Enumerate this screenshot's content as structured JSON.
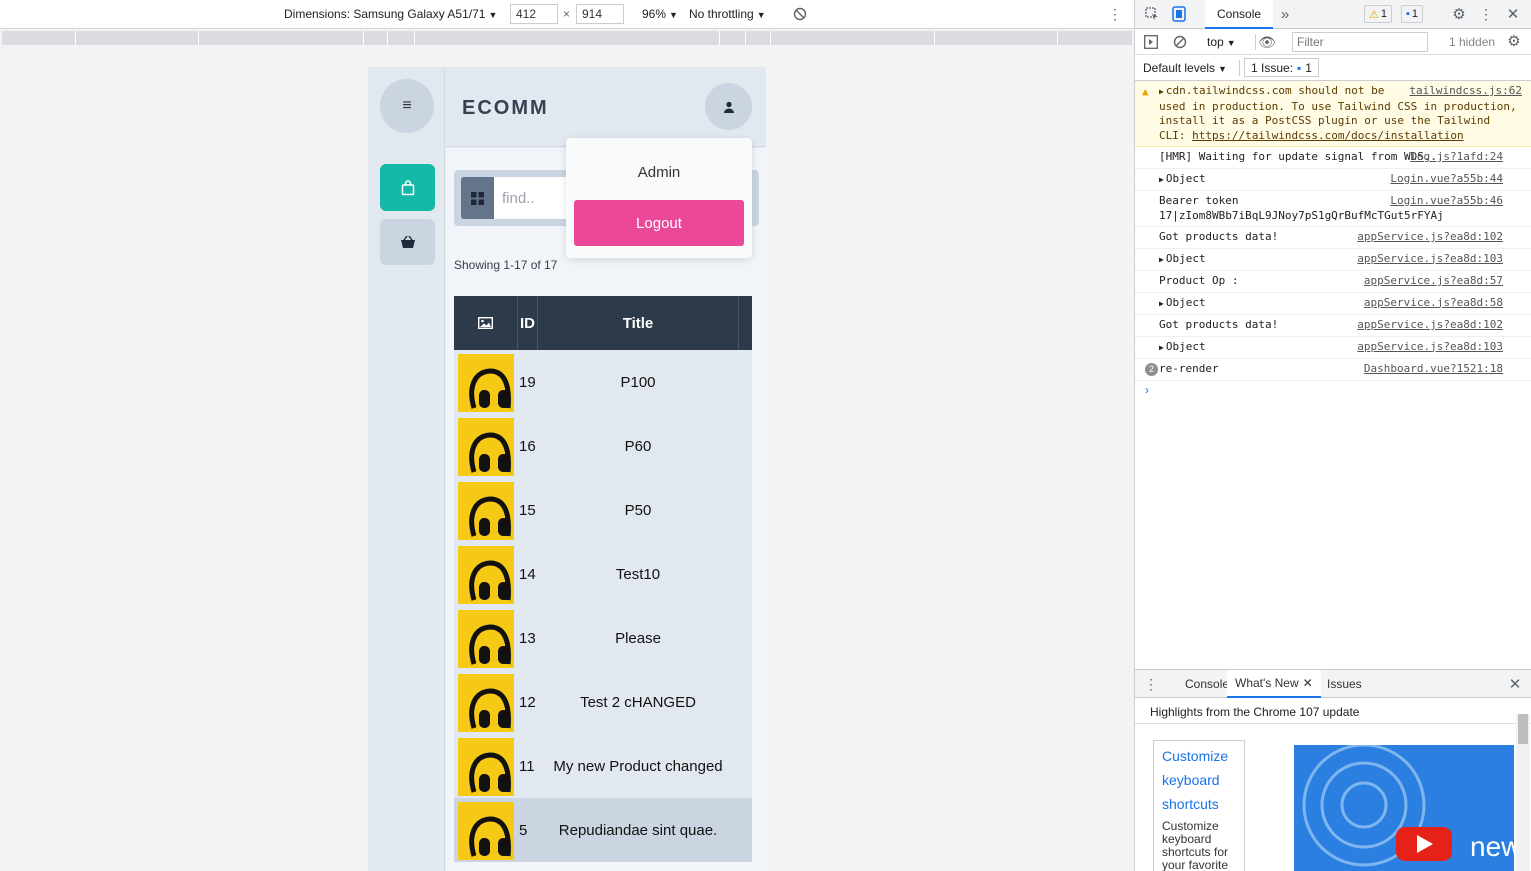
{
  "device_toolbar": {
    "dimensions_label": "Dimensions: Samsung Galaxy A51/71",
    "width": "412",
    "times": "×",
    "height": "914",
    "zoom": "96%",
    "throttling": "No throttling"
  },
  "app": {
    "brand": "ECOMM",
    "search_placeholder": "find..",
    "showing": "Showing 1-17 of 17",
    "table": {
      "headers": {
        "id": "ID",
        "title": "Title"
      },
      "rows": [
        {
          "id": "19",
          "title": "P100"
        },
        {
          "id": "16",
          "title": "P60"
        },
        {
          "id": "15",
          "title": "P50"
        },
        {
          "id": "14",
          "title": "Test10"
        },
        {
          "id": "13",
          "title": "Please"
        },
        {
          "id": "12",
          "title": "Test 2 cHANGED"
        },
        {
          "id": "11",
          "title": "My new Product changed"
        },
        {
          "id": "5",
          "title": "Repudiandae sint quae."
        }
      ]
    },
    "user_menu": {
      "name": "Admin",
      "logout": "Logout"
    },
    "colors": {
      "accent": "#14b8a6",
      "logout": "#ec4899",
      "table_header": "#2d3a4a"
    }
  },
  "devtools": {
    "tabs": {
      "console": "Console",
      "more": "»"
    },
    "warnings_count": "1",
    "messages_count": "1",
    "context": "top",
    "filter_placeholder": "Filter",
    "hidden": "1 hidden",
    "levels": "Default levels",
    "issues": "1 Issue:",
    "issues_count": "1",
    "logs": [
      {
        "kind": "warn",
        "text": "cdn.tailwindcss.com should not be used in production. To use Tailwind CSS in production, install it as a PostCSS plugin or use the Tailwind CLI: ",
        "link": "https://tailwindcss.com/docs/installation",
        "src": "tailwindcss.js:62"
      },
      {
        "kind": "log",
        "text": "[HMR] Waiting for update signal from WDS...",
        "src": "log.js?1afd:24"
      },
      {
        "kind": "obj",
        "text": "Object",
        "src": "Login.vue?a55b:44"
      },
      {
        "kind": "log",
        "text": "Bearer token 17|zIom8WBb7iBqL9JNoy7pS1gQrBufMcTGut5rFYAj",
        "src": "Login.vue?a55b:46"
      },
      {
        "kind": "log",
        "text": "Got products data!",
        "src": "appService.js?ea8d:102"
      },
      {
        "kind": "obj",
        "text": "Object",
        "src": "appService.js?ea8d:103"
      },
      {
        "kind": "log",
        "text": "Product Op :",
        "src": "appService.js?ea8d:57"
      },
      {
        "kind": "obj",
        "text": "Object",
        "src": "appService.js?ea8d:58"
      },
      {
        "kind": "log",
        "text": "Got products data!",
        "src": "appService.js?ea8d:102"
      },
      {
        "kind": "obj",
        "text": "Object",
        "src": "appService.js?ea8d:103"
      },
      {
        "kind": "count",
        "count": "2",
        "text": "re-render",
        "src": "Dashboard.vue?1521:18"
      }
    ],
    "drawer": {
      "tabs": {
        "console": "Console",
        "whats_new": "What's New",
        "issues": "Issues"
      },
      "header": "Highlights from the Chrome 107 update",
      "card_link": "Customize keyboard shortcuts",
      "card_desc": "Customize keyboard shortcuts for your favorite",
      "image_text": "new"
    }
  }
}
